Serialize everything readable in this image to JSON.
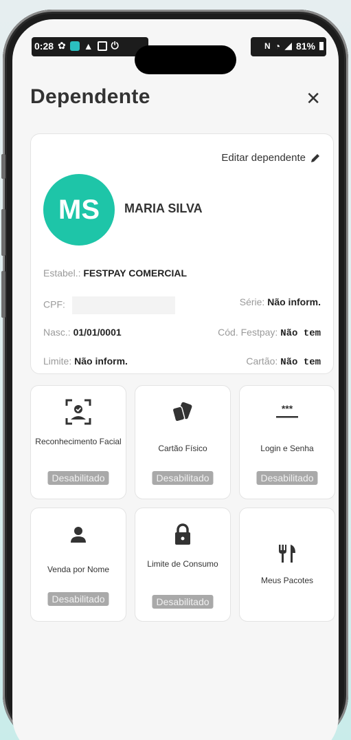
{
  "status_bar": {
    "time": "0:28",
    "battery": "81%"
  },
  "header": {
    "title": "Dependente",
    "close": "✕"
  },
  "profile": {
    "edit_label": "Editar dependente",
    "initials": "MS",
    "name": "MARIA SILVA",
    "avatar_color": "#1ec5a8",
    "estab_label": "Estabel.:",
    "estab_value": "FESTPAY COMERCIAL",
    "cpf_label": "CPF:",
    "serie_label": "Série:",
    "serie_value": "Não inform.",
    "nasc_label": "Nasc.:",
    "nasc_value": "01/01/0001",
    "cod_label": "Cód. Festpay:",
    "cod_value": "Não tem",
    "limite_label": "Limite:",
    "limite_value": "Não inform.",
    "cartao_label": "Cartão:",
    "cartao_value": "Não tem"
  },
  "tiles": [
    {
      "label": "Reconhecimento Facial",
      "status": "Desabilitado",
      "icon": "face-recognition-icon"
    },
    {
      "label": "Cartão Físico",
      "status": "Desabilitado",
      "icon": "card-icon"
    },
    {
      "label": "Login e Senha",
      "status": "Desabilitado",
      "icon": "password-icon"
    },
    {
      "label": "Venda por Nome",
      "status": "Desabilitado",
      "icon": "person-icon"
    },
    {
      "label": "Limite de Consumo",
      "status": "Desabilitado",
      "icon": "lock-icon"
    },
    {
      "label": "Meus Pacotes",
      "status": "",
      "icon": "cutlery-icon"
    }
  ],
  "colors": {
    "badge_bg": "#a9a9a9",
    "card_border": "#e3e3e3"
  }
}
